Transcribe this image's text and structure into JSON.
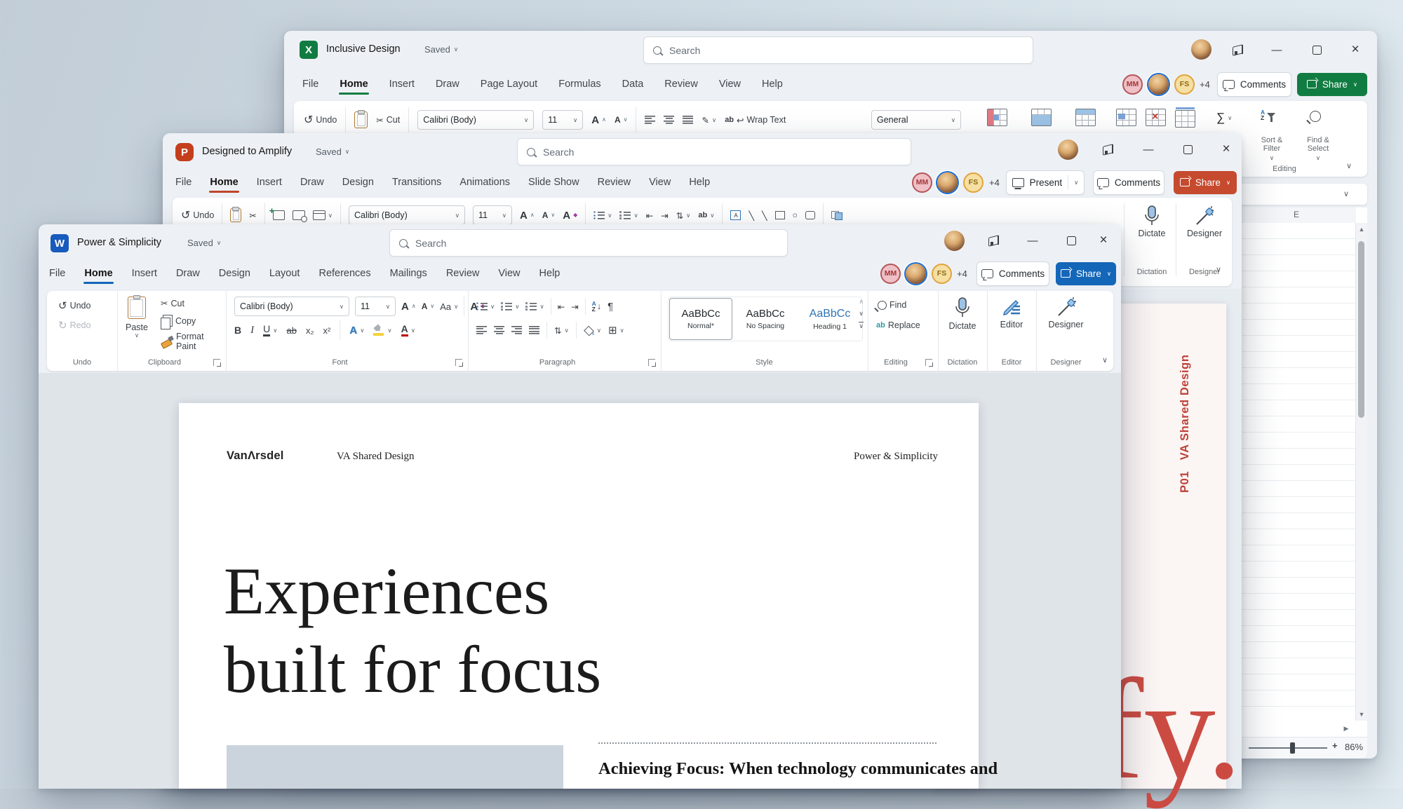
{
  "colors": {
    "excel_accent": "#107C41",
    "powerpoint_accent": "#C43E1C",
    "word_accent": "#185ABD",
    "word_share": "#1366B8",
    "slide_red": "#C94B42",
    "heading1_blue": "#2E74B5"
  },
  "glyphs": {
    "chevron_down": "∨",
    "chevron_up": "∧",
    "scissors": "✂",
    "undo": "↺",
    "redo": "↻",
    "pilcrow": "¶",
    "sigma": "∑",
    "tri_up": "▲",
    "tri_down": "▼",
    "tri_right": "▶",
    "close": "×",
    "minimize": "—",
    "bold": "B",
    "italic": "I",
    "underline": "U",
    "strike_ab": "ab",
    "subscript": "x₂",
    "superscript": "x²",
    "letter_a": "A",
    "aa": "Aa",
    "ab": "ab",
    "return_arrow": "↩",
    "pen": "✎",
    "diag_line": "╲",
    "oval": "○",
    "arrow_down": "↓",
    "plus": "+",
    "sort_a": "A",
    "sort_z": "Z",
    "spacing_arrows": "⇅",
    "borders_grid": "⊞",
    "indent_increase": "⇥",
    "indent_decrease": "⇤",
    "clear_fmt_mark": "◆"
  },
  "excel": {
    "app_letter": "X",
    "title": "Inclusive Design",
    "saved": "Saved",
    "search_placeholder": "Search",
    "menu": [
      "File",
      "Home",
      "Insert",
      "Draw",
      "Page Layout",
      "Formulas",
      "Data",
      "Review",
      "View",
      "Help"
    ],
    "ribbon": {
      "undo": "Undo",
      "cut": "Cut",
      "font_name": "Calibri (Body)",
      "font_size": "11",
      "wrap_text": "Wrap Text",
      "number_format": "General",
      "sort_filter_1": "Sort &",
      "sort_filter_2": "Filter",
      "find_select_1": "Find &",
      "find_select_2": "Select",
      "editing_label": "Editing"
    },
    "collab": {
      "badge_mm": "MM",
      "badge_fs": "FS",
      "more": "+4",
      "comments": "Comments",
      "share": "Share"
    },
    "sheet": {
      "column_header": "E",
      "zoom_level": "86%"
    }
  },
  "powerpoint": {
    "app_letter": "P",
    "title": "Designed to Amplify",
    "saved": "Saved",
    "search_placeholder": "Search",
    "menu": [
      "File",
      "Home",
      "Insert",
      "Draw",
      "Design",
      "Transitions",
      "Animations",
      "Slide Show",
      "Review",
      "View",
      "Help"
    ],
    "ribbon": {
      "undo": "Undo",
      "font_name": "Calibri (Body)",
      "font_size": "11",
      "dictate": "Dictate",
      "dictation_group": "Dictation",
      "designer": "Designer",
      "designer_group": "Designer"
    },
    "collab": {
      "badge_mm": "MM",
      "badge_fs": "FS",
      "more": "+4",
      "present": "Present",
      "comments": "Comments",
      "share": "Share"
    },
    "slide": {
      "side_label": "P01   VA Shared Design",
      "big_text": "fy."
    }
  },
  "word": {
    "app_letter": "W",
    "title": "Power & Simplicity",
    "saved": "Saved",
    "search_placeholder": "Search",
    "menu": [
      "File",
      "Home",
      "Insert",
      "Draw",
      "Design",
      "Layout",
      "References",
      "Mailings",
      "Review",
      "View",
      "Help"
    ],
    "ribbon": {
      "undo": "Undo",
      "redo": "Redo",
      "paste": "Paste",
      "cut": "Cut",
      "copy": "Copy",
      "format_painter": "Format Paint",
      "font_name": "Calibri (Body)",
      "font_size": "11",
      "styles": [
        {
          "sample": "AaBbCc",
          "name": "Normal*"
        },
        {
          "sample": "AaBbCc",
          "name": "No Spacing"
        },
        {
          "sample": "AaBbCc",
          "name": "Heading 1"
        }
      ],
      "find": "Find",
      "replace": "Replace",
      "dictate": "Dictate",
      "editor": "Editor",
      "designer": "Designer",
      "groups": {
        "undo": "Undo",
        "clipboard": "Clipboard",
        "font": "Font",
        "paragraph": "Paragraph",
        "style": "Style",
        "editing": "Editing",
        "dictation": "Dictation",
        "editor": "Editor",
        "designer": "Designer"
      }
    },
    "collab": {
      "badge_mm": "MM",
      "badge_fs": "FS",
      "more": "+4",
      "comments": "Comments",
      "share": "Share"
    },
    "document": {
      "logo": "VanΛrsdel",
      "header_center": "VA Shared Design",
      "header_right": "Power & Simplicity",
      "heading_line1": "Experiences",
      "heading_line2": "built for focus",
      "body_heading": "Achieving Focus: When technology communicates and"
    }
  }
}
